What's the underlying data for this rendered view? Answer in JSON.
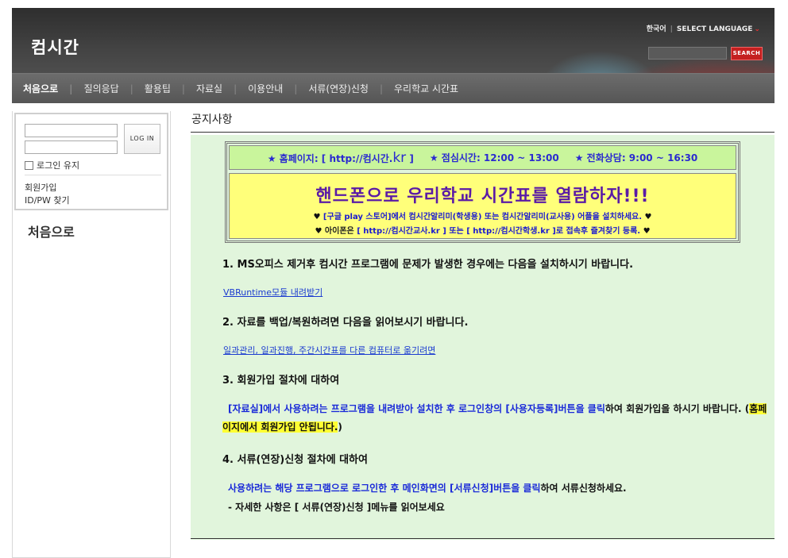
{
  "header": {
    "site_title": "컴시간",
    "lang_current": "한국어",
    "lang_select": "SELECT LANGUAGE",
    "search_button": "SEARCH",
    "search_placeholder": ""
  },
  "nav": {
    "items": [
      "처음으로",
      "질의응답",
      "활용팁",
      "자료실",
      "이용안내",
      "서류(연장)신청",
      "우리학교 시간표"
    ]
  },
  "sidebar": {
    "login_button": "LOG IN",
    "keep_login": "로그인 유지",
    "join": "회원가입",
    "find": "ID/PW 찾기",
    "title": "처음으로"
  },
  "main": {
    "page_title": "공지사항",
    "notice": {
      "homepage_label": "★ 홈페이지: [",
      "homepage_url_prefix": "http://컴시간.",
      "homepage_url_suffix": "kr",
      "homepage_close": "]",
      "lunch": "★ 점심시간: 12:00 ~ 13:00",
      "phone": "★ 전화상담: 9:00 ~ 16:30",
      "headline": "핸드폰으로 우리학교 시간표를 열람하자!!!",
      "line1": "[구글 play 스토어]에서 컴시간알리미(학생용) 또는 컴시간알리미(교사용) 어플을 설치하세요.",
      "line2_lead": "아이폰은",
      "line2": "[ http://컴시간교사.kr ] 또는 [ http://컴시간학생.kr ]로 접속후 즐겨찾기 등록.",
      "heart": "♥"
    },
    "sections": [
      {
        "title": "1. MS오피스 제거후 컴시간 프로그램에 문제가 발생한 경우에는 다음을 설치하시기 바랍니다.",
        "link": "VBRuntime모듈 내려받기"
      },
      {
        "title": "2. 자료를 백업/복원하려면 다음을 읽어보시기 바랍니다.",
        "link": "일과관리, 일과진행, 주간시간표를 다른 컴퓨터로 옮기려면"
      },
      {
        "title": "3. 회원가입 절차에 대하여"
      },
      {
        "title": "4. 서류(연장)신청 절차에 대하여"
      }
    ],
    "sec3_blue": "[자료실]에서 사용하려는 프로그램을 내려받아 설치한 후 로그인창의 [사용자등록]버튼을 클릭",
    "sec3_black": "하여 회원가입을 하시기 바랍니다. (",
    "sec3_highlight": "홈페이지에서 회원가입 안됩니다.",
    "sec3_end": ")",
    "sec4_blue": "사용하려는 해당 프로그램으로 로그인한 후 메인화면의 [서류신청]버튼을 클릭",
    "sec4_black": "하여 서류신청하세요.",
    "sec4_note": "- 자세한 사항은 [ 서류(연장)신청 ]메뉴를 읽어보세요"
  },
  "colors": {
    "content_bg": "#e1f5dc",
    "info_bar": "#c9f59c",
    "headline_bg": "#ffff7a",
    "headline_text": "#5a1aa6",
    "link_blue": "#1a2ad8",
    "search_red": "#c42020"
  }
}
